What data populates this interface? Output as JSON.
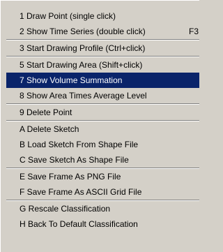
{
  "menu": {
    "items": [
      {
        "label": "1 Draw Point (single click)"
      },
      {
        "label": "2 Show Time Series (double click)",
        "shortcut": "F3"
      },
      {
        "label": "3 Start Drawing Profile (Ctrl+click)"
      },
      {
        "label": "5 Start Drawing Area (Shift+click)"
      },
      {
        "label": "7 Show Volume Summation",
        "selected": true
      },
      {
        "label": "8 Show Area Times Average Level"
      },
      {
        "label": "9 Delete Point"
      },
      {
        "label": "A Delete Sketch"
      },
      {
        "label": "B Load Sketch From Shape File"
      },
      {
        "label": "C Save Sketch As Shape File"
      },
      {
        "label": "E Save Frame As PNG File"
      },
      {
        "label": "F Save Frame As ASCII Grid File"
      },
      {
        "label": "G Rescale Classification"
      },
      {
        "label": "H Back To Default Classification"
      }
    ]
  },
  "colors": {
    "menu_background": "#d4d0c8",
    "highlight_background": "#0a246a",
    "highlight_text": "#ffffff"
  }
}
